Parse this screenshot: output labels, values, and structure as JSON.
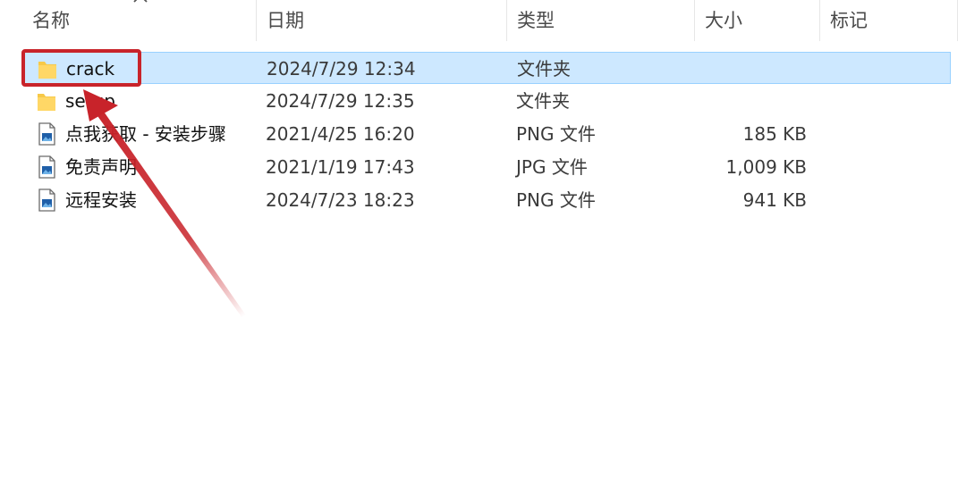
{
  "columns": {
    "name": "名称",
    "date": "日期",
    "type": "类型",
    "size": "大小",
    "tags": "标记"
  },
  "files": [
    {
      "name": "crack",
      "date": "2024/7/29 12:34",
      "type": "文件夹",
      "size": "",
      "icon": "folder-icon",
      "selected": true
    },
    {
      "name": "setup",
      "date": "2024/7/29 12:35",
      "type": "文件夹",
      "size": "",
      "icon": "folder-icon",
      "selected": false
    },
    {
      "name": "点我获取 - 安装步骤",
      "date": "2021/4/25 16:20",
      "type": "PNG 文件",
      "size": "185 KB",
      "icon": "image-file-icon",
      "selected": false
    },
    {
      "name": "免责声明",
      "date": "2021/1/19 17:43",
      "type": "JPG 文件",
      "size": "1,009 KB",
      "icon": "image-file-icon",
      "selected": false
    },
    {
      "name": "远程安装",
      "date": "2024/7/23 18:23",
      "type": "PNG 文件",
      "size": "941 KB",
      "icon": "image-file-icon",
      "selected": false
    }
  ],
  "colors": {
    "selection_bg": "#cde8ff",
    "selection_border": "#99d1ff",
    "annotation_red": "#c8232a",
    "folder_yellow": "#ffd766"
  }
}
